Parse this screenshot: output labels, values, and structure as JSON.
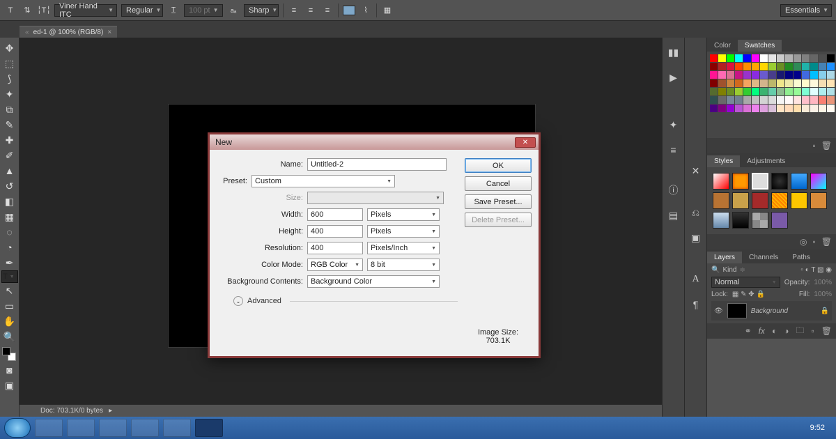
{
  "topbar": {
    "font_family": "Viner Hand ITC",
    "font_style": "Regular",
    "font_size": "100 pt",
    "antialiasing": "Sharp",
    "workspace": "Essentials"
  },
  "doc_tab": {
    "title": "ed-1 @ 100% (RGB/8)"
  },
  "statusbar": {
    "docinfo": "Doc: 703.1K/0 bytes"
  },
  "dialog": {
    "title": "New",
    "name_label": "Name:",
    "name_value": "Untitled-2",
    "preset_label": "Preset:",
    "preset_value": "Custom",
    "size_label": "Size:",
    "width_label": "Width:",
    "width_value": "600",
    "width_unit": "Pixels",
    "height_label": "Height:",
    "height_value": "400",
    "height_unit": "Pixels",
    "res_label": "Resolution:",
    "res_value": "400",
    "res_unit": "Pixels/Inch",
    "mode_label": "Color Mode:",
    "mode_value": "RGB Color",
    "depth_value": "8 bit",
    "bg_label": "Background Contents:",
    "bg_value": "Background Color",
    "advanced": "Advanced",
    "imgsize_label": "Image Size:",
    "imgsize_value": "703.1K",
    "ok": "OK",
    "cancel": "Cancel",
    "save_preset": "Save Preset...",
    "delete_preset": "Delete Preset..."
  },
  "panels": {
    "color_tab": "Color",
    "swatches_tab": "Swatches",
    "styles_tab": "Styles",
    "adjustments_tab": "Adjustments",
    "layers_tab": "Layers",
    "channels_tab": "Channels",
    "paths_tab": "Paths",
    "kind_label": "Kind",
    "blend_mode": "Normal",
    "opacity_label": "Opacity:",
    "opacity_value": "100%",
    "lock_label": "Lock:",
    "fill_label": "Fill:",
    "fill_value": "100%",
    "background_layer": "Background"
  },
  "swatch_colors": [
    "#ff0000",
    "#ffff00",
    "#00ff00",
    "#00ffff",
    "#0000ff",
    "#ff00ff",
    "#ffffff",
    "#e6e6e6",
    "#cccccc",
    "#b3b3b3",
    "#999999",
    "#808080",
    "#666666",
    "#4d4d4d",
    "#000000",
    "#8b0000",
    "#b22222",
    "#dc143c",
    "#ff4500",
    "#ff8c00",
    "#ffa500",
    "#ffd700",
    "#9acd32",
    "#6b8e23",
    "#228b22",
    "#2e8b57",
    "#20b2aa",
    "#008b8b",
    "#4682b4",
    "#1e90ff",
    "#ff1493",
    "#ff69b4",
    "#db7093",
    "#c71585",
    "#9932cc",
    "#8a2be2",
    "#6a5acd",
    "#483d8b",
    "#191970",
    "#000080",
    "#00008b",
    "#4169e1",
    "#00bfff",
    "#87ceeb",
    "#add8e6",
    "#800000",
    "#a0522d",
    "#cd853f",
    "#d2691e",
    "#f4a460",
    "#deb887",
    "#d2b48c",
    "#bdb76b",
    "#f0e68c",
    "#eee8aa",
    "#fafad2",
    "#fffacd",
    "#fff8dc",
    "#f5deb3",
    "#ffe4b5",
    "#556b2f",
    "#808000",
    "#6b8e23",
    "#9acd32",
    "#32cd32",
    "#00ff7f",
    "#3cb371",
    "#66cdaa",
    "#8fbc8f",
    "#90ee90",
    "#98fb98",
    "#7fffd4",
    "#e0ffff",
    "#afeeee",
    "#b0e0e6",
    "#2f4f4f",
    "#696969",
    "#778899",
    "#708090",
    "#a9a9a9",
    "#c0c0c0",
    "#d3d3d3",
    "#dcdcdc",
    "#f5f5f5",
    "#fffafa",
    "#ffe4e1",
    "#ffc0cb",
    "#ffb6c1",
    "#fa8072",
    "#e9967a",
    "#4b0082",
    "#800080",
    "#9400d3",
    "#ba55d3",
    "#da70d6",
    "#ee82ee",
    "#dda0dd",
    "#d8bfd8",
    "#ffe4c4",
    "#ffdab9",
    "#ffdead",
    "#faebd7",
    "#faf0e6",
    "#fdf5e6",
    "#fffaf0"
  ],
  "taskbar": {
    "time": "9:52"
  }
}
